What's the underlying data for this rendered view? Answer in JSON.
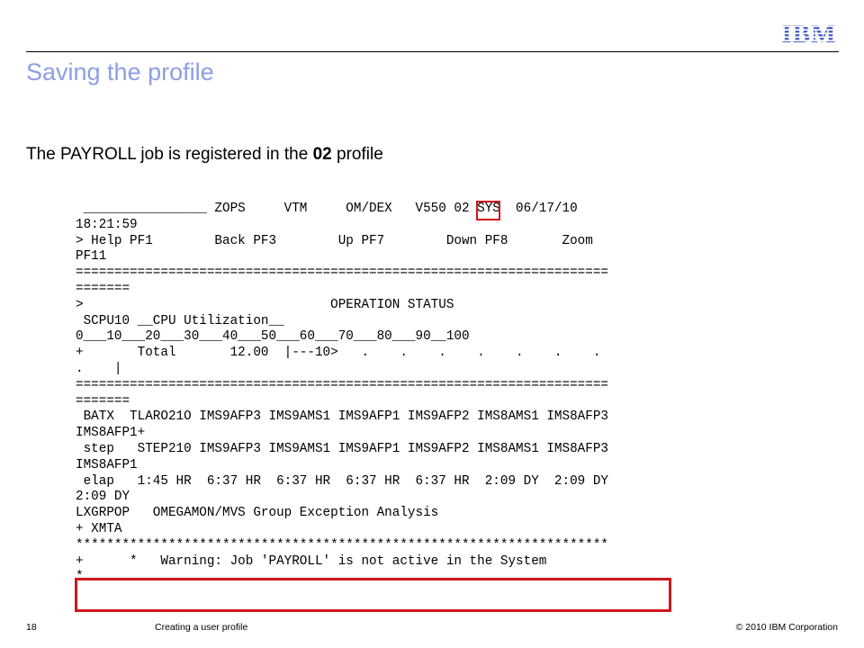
{
  "header": {
    "logo_text": "IBM"
  },
  "slide": {
    "title": "Saving the profile",
    "subtitle_before": "The PAYROLL job is registered in the ",
    "subtitle_bold": "02",
    "subtitle_after": " profile"
  },
  "terminal": {
    "lines": [
      " ________________ ZOPS     VTM     OM/DEX   V550 02 SYS  06/17/10",
      "18:21:59",
      "> Help PF1        Back PF3        Up PF7        Down PF8       Zoom",
      "PF11",
      "=====================================================================",
      "=======",
      ">                                OPERATION STATUS",
      "",
      " SCPU10 __CPU Utilization__",
      "0___10___20___30___40___50___60___70___80___90__100",
      "+       Total       12.00  |---10>   .    .    .    .    .    .    .",
      ".    |",
      "=====================================================================",
      "=======",
      " BATX  TLARO21O IMS9AFP3 IMS9AMS1 IMS9AFP1 IMS9AFP2 IMS8AMS1 IMS8AFP3",
      "IMS8AFP1+",
      " step   STEP210 IMS9AFP3 IMS9AMS1 IMS9AFP1 IMS9AFP2 IMS8AMS1 IMS8AFP3",
      "IMS8AFP1",
      " elap   1:45 HR  6:37 HR  6:37 HR  6:37 HR  6:37 HR  2:09 DY  2:09 DY",
      "2:09 DY",
      "",
      "LXGRPOP   OMEGAMON/MVS Group Exception Analysis",
      "+ XMTA",
      "*********************************************************************",
      "+      *   Warning: Job 'PAYROLL' is not active in the System",
      "*"
    ]
  },
  "footer": {
    "page_number": "18",
    "section": "Creating a user profile",
    "copyright": "© 2010 IBM Corporation"
  },
  "colors": {
    "title": "#8c9ee6",
    "highlight": "#d0171b",
    "logo": "#4a63c8"
  }
}
